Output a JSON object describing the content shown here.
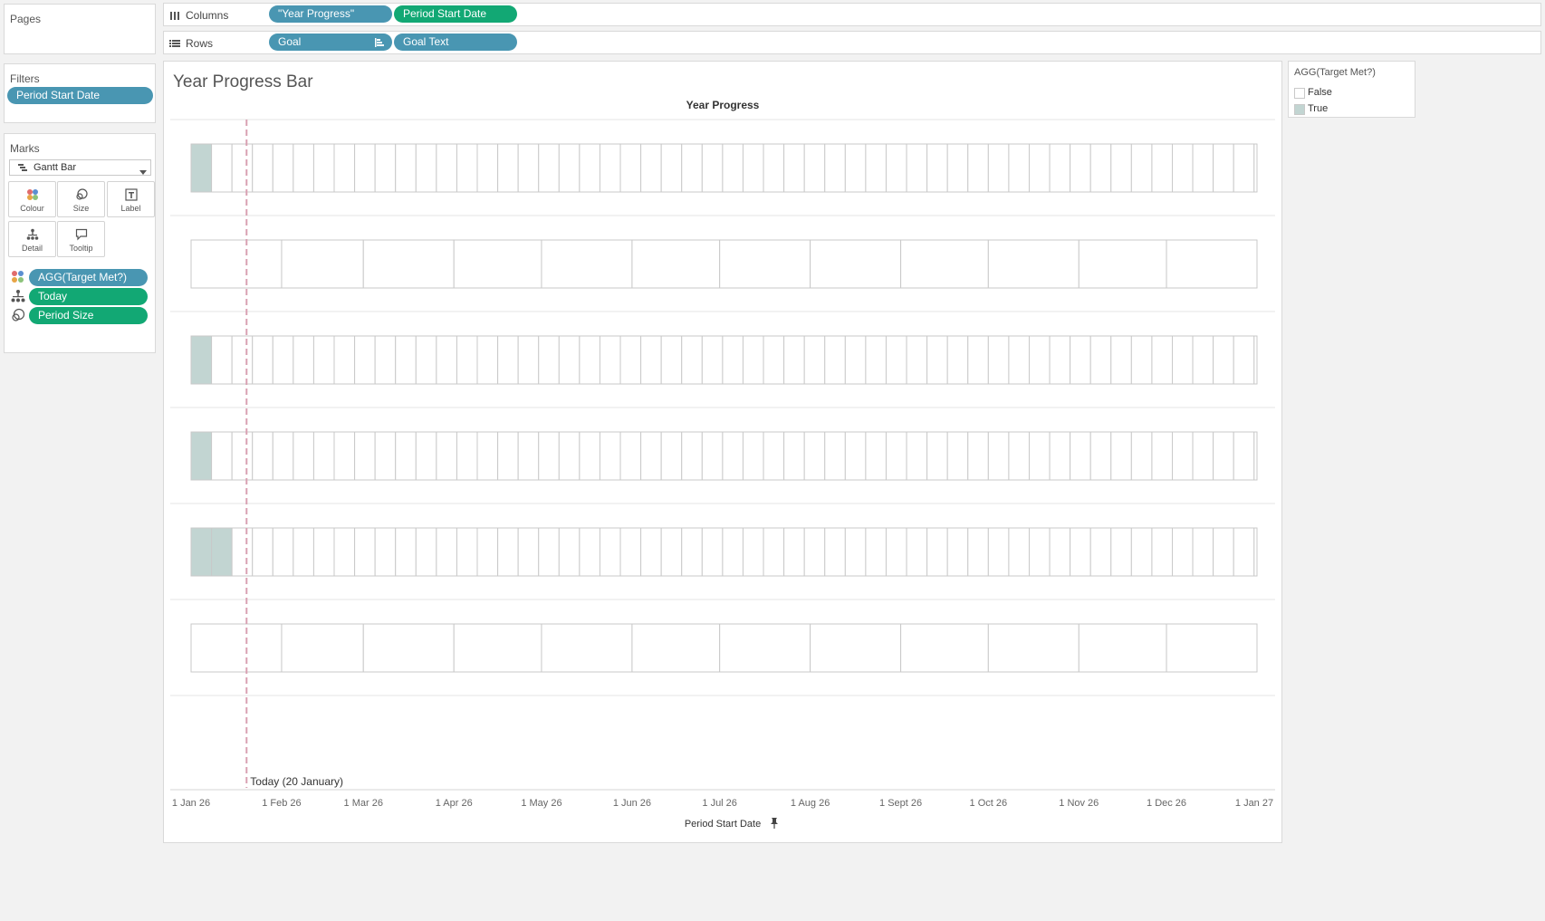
{
  "pages": {
    "title": "Pages"
  },
  "columns_shelf": {
    "label": "Columns",
    "pills": [
      {
        "label": "\"Year Progress\"",
        "color": "blue"
      },
      {
        "label": "Period Start Date",
        "color": "green"
      }
    ]
  },
  "rows_shelf": {
    "label": "Rows",
    "pills": [
      {
        "label": "Goal",
        "color": "blue"
      },
      {
        "label": "Goal Text",
        "color": "blue"
      }
    ]
  },
  "filters": {
    "title": "Filters",
    "pills": [
      {
        "label": "Period Start Date"
      }
    ]
  },
  "marks": {
    "title": "Marks",
    "mark_type": "Gantt Bar",
    "cards": [
      {
        "label": "Colour",
        "icon": "colour-icon"
      },
      {
        "label": "Size",
        "icon": "size-icon"
      },
      {
        "label": "Label",
        "icon": "label-icon"
      },
      {
        "label": "Detail",
        "icon": "detail-icon"
      },
      {
        "label": "Tooltip",
        "icon": "tooltip-icon"
      }
    ],
    "fields": [
      {
        "label": "AGG(Target Met?)",
        "encoding": "colour",
        "color": "blue"
      },
      {
        "label": "Today",
        "encoding": "detail",
        "color": "green"
      },
      {
        "label": "Period Size",
        "encoding": "size",
        "color": "green"
      }
    ]
  },
  "view": {
    "title": "Year Progress Bar"
  },
  "legend": {
    "title": "AGG(Target Met?)",
    "items": [
      {
        "label": "False",
        "color": "#ffffff"
      },
      {
        "label": "True",
        "color": "#c2d5d2"
      }
    ]
  },
  "colors": {
    "true_fill": "#c2d5d2",
    "false_fill": "#ffffff",
    "cell_border": "#c9c9c9",
    "today_line": "#d9a0b2",
    "pill_blue": "#4996b2",
    "pill_green": "#12a874"
  },
  "chart_data": {
    "type": "gantt",
    "title": "Year Progress",
    "xlabel": "Period Start Date",
    "x_ticks": [
      "1 Jan 26",
      "1 Feb 26",
      "1 Mar 26",
      "1 Apr 26",
      "1 May 26",
      "1 Jun 26",
      "1 Jul 26",
      "1 Aug 26",
      "1 Sept 26",
      "1 Oct 26",
      "1 Nov 26",
      "1 Dec 26",
      "1 Jan 27"
    ],
    "xlim": [
      "2026-01-01",
      "2027-01-01"
    ],
    "reference_line": {
      "date": "2026-01-20",
      "label": "Today (20 January)"
    },
    "rows": [
      {
        "period": "week",
        "true_periods": 1
      },
      {
        "period": "month",
        "true_periods": 0
      },
      {
        "period": "week",
        "true_periods": 1
      },
      {
        "period": "week",
        "true_periods": 1
      },
      {
        "period": "week",
        "true_periods": 2
      },
      {
        "period": "month",
        "true_periods": 0
      }
    ]
  }
}
